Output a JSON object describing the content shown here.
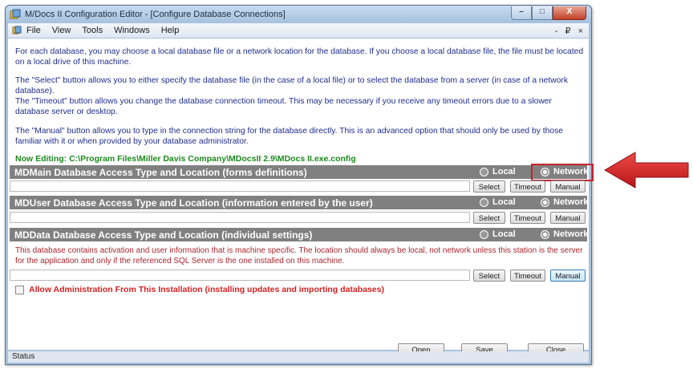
{
  "window": {
    "title": "M/Docs II Configuration Editor - [Configure Database Connections]",
    "controls": {
      "minimize": "–",
      "maximize": "□",
      "close": "X"
    }
  },
  "menu": {
    "items": [
      "File",
      "View",
      "Tools",
      "Windows",
      "Help"
    ],
    "mdi_controls": "- ₽ ×"
  },
  "instructions": [
    "For each database, you may choose a local database file or a network location for the database. If you choose a local database file, the file must be located on a local drive of this machine.",
    "The \"Select\" button allows you to either specify the database file (in the case of a local file) or to select the database from a server (in case of a network database).",
    "The \"Timeout\" button allows you change the database connection timeout.  This may be necessary if you receive any timeout errors due to a slower database server or desktop.",
    "The \"Manual\" button allows you to type in the connection string for the database directly.  This is an advanced option that should only be used by those familiar with it or when provided by your database administrator."
  ],
  "now_editing": "Now Editing: C:\\Program Files\\Miller Davis Company\\MDocsII 2.9\\MDocs II.exe.config",
  "sections": [
    {
      "title": "MDMain Database Access Type and Location (forms definitions)",
      "local_label": "Local",
      "network_label": "Network",
      "selected": "network",
      "path": ""
    },
    {
      "title": "MDUser Database Access Type and Location (information entered by the user)",
      "local_label": "Local",
      "network_label": "Network",
      "selected": "network",
      "path": ""
    },
    {
      "title": "MDData Database Access Type and Location (individual settings)",
      "local_label": "Local",
      "network_label": "Network",
      "selected": "network",
      "path": ""
    }
  ],
  "buttons": {
    "select": "Select",
    "timeout": "Timeout",
    "manual": "Manual"
  },
  "mddata_warning": "This database contains activation and user information that is machine specific.  The location should always be local, not network unless this station is the server for the application and only if the referenced SQL Server is the one installed on this machine.",
  "admin_checkbox": {
    "label": "Allow Administration From This Installation (installing updates and importing databases)",
    "checked": false
  },
  "footer": {
    "open": "Open",
    "save": "Save",
    "close": "Close"
  },
  "status": "Status",
  "colors": {
    "section_header": "#808080",
    "highlight": "#c8222a",
    "editing_text": "#1d8a1d",
    "warning_text": "#a8262e",
    "arrow": "#d7262a"
  }
}
